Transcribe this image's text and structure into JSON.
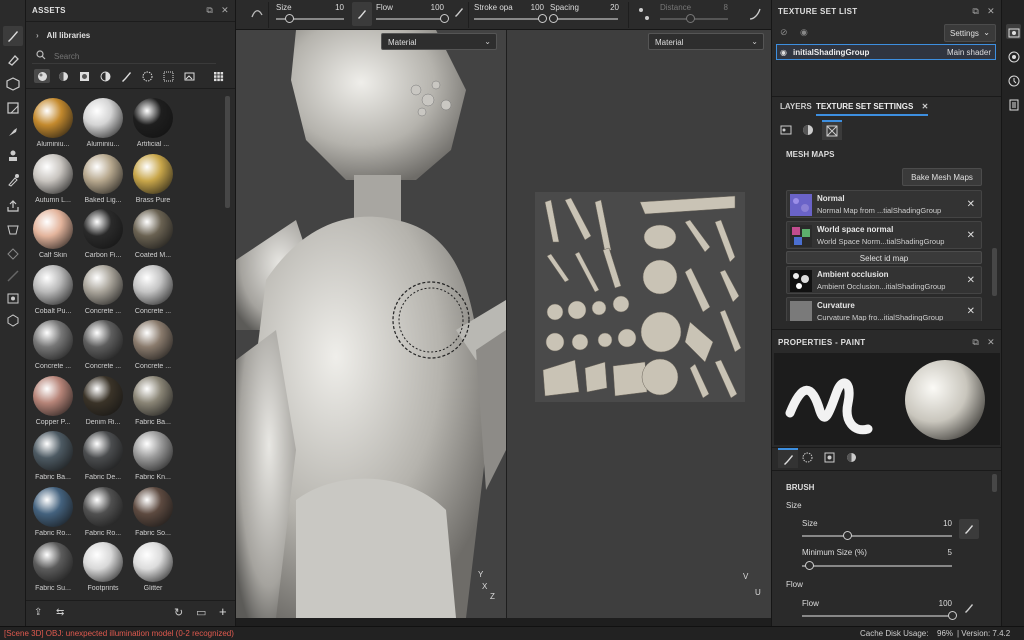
{
  "assets": {
    "title": "ASSETS",
    "all_libraries": "All libraries",
    "search_placeholder": "Search",
    "materials": [
      {
        "label": "Aluminiu...",
        "color": "#c48a2e"
      },
      {
        "label": "Aluminiu...",
        "color": "#d4d4d4"
      },
      {
        "label": "Artificial ...",
        "color": "#1e1e1e"
      },
      {
        "label": "Autumn L...",
        "color": "#c9c5c0"
      },
      {
        "label": "Baked Lig...",
        "color": "#b7a88e"
      },
      {
        "label": "Brass Pure",
        "color": "#c8a64a"
      },
      {
        "label": "Calf Skin",
        "color": "#e3b49c"
      },
      {
        "label": "Carbon Fi...",
        "color": "#2a2a2a"
      },
      {
        "label": "Coated M...",
        "color": "#6a6252"
      },
      {
        "label": "Cobalt Pu...",
        "color": "#b9b9b9"
      },
      {
        "label": "Concrete ...",
        "color": "#a9a49a"
      },
      {
        "label": "Concrete ...",
        "color": "#c4c4c4"
      },
      {
        "label": "Concrete ...",
        "color": "#777777"
      },
      {
        "label": "Concrete ...",
        "color": "#5e5e5e"
      },
      {
        "label": "Concrete ...",
        "color": "#8a7b6d"
      },
      {
        "label": "Copper P...",
        "color": "#b68478"
      },
      {
        "label": "Denim Ri...",
        "color": "#3a3328"
      },
      {
        "label": "Fabric Ba...",
        "color": "#8a8576"
      },
      {
        "label": "Fabric Ba...",
        "color": "#4d5a63"
      },
      {
        "label": "Fabric De...",
        "color": "#4b4d4f"
      },
      {
        "label": "Fabric Kn...",
        "color": "#9a9a9a"
      },
      {
        "label": "Fabric Ro...",
        "color": "#44627e"
      },
      {
        "label": "Fabric Ro...",
        "color": "#505050"
      },
      {
        "label": "Fabric So...",
        "color": "#5d4a40"
      },
      {
        "label": "Fabric Su...",
        "color": "#5c5c5c"
      },
      {
        "label": "Footprints",
        "color": "#d8d8d8"
      },
      {
        "label": "Glitter",
        "color": "#dcdcdc"
      }
    ]
  },
  "toolbar": {
    "size_label": "Size",
    "size_value": "10",
    "size_fraction": 0.2,
    "flow_label": "Flow",
    "flow_value": "100",
    "flow_fraction": 1.0,
    "stroke_label": "Stroke opa",
    "stroke_value": "100",
    "stroke_fraction": 1.0,
    "spacing_label": "Spacing",
    "spacing_value": "20",
    "spacing_fraction": 0.05,
    "distance_label": "Distance",
    "distance_value": "8",
    "distance_fraction": 0.45
  },
  "viewport": {
    "left_dropdown": "Material",
    "right_dropdown": "Material",
    "axis_y": "Y",
    "axis_x": "X",
    "axis_z": "Z",
    "axis2_v": "V",
    "axis2_u": "U"
  },
  "texture_set_list": {
    "title": "TEXTURE SET LIST",
    "settings_button": "Settings",
    "set_name": "initialShadingGroup",
    "shader": "Main shader"
  },
  "tabs": {
    "layers": "LAYERS",
    "texture_set_settings": "TEXTURE SET SETTINGS"
  },
  "mesh_maps": {
    "title": "MESH MAPS",
    "bake_button": "Bake Mesh Maps",
    "select_id_map": "Select id map",
    "items": [
      {
        "title": "Normal",
        "sub": "Normal Map from ...tialShadingGroup"
      },
      {
        "title": "World space normal",
        "sub": "World Space Norm...tialShadingGroup"
      },
      {
        "title": "Ambient occlusion",
        "sub": "Ambient Occlusion...itialShadingGroup"
      },
      {
        "title": "Curvature",
        "sub": "Curvature Map fro...itialShadingGroup"
      }
    ]
  },
  "properties": {
    "title": "PROPERTIES - PAINT",
    "brush_section": "BRUSH",
    "size_group": "Size",
    "size_label": "Size",
    "size_value": "10",
    "size_fraction": 0.3,
    "min_size_label": "Minimum Size (%)",
    "min_size_value": "5",
    "min_size_fraction": 0.05,
    "flow_group": "Flow",
    "flow_label": "Flow",
    "flow_value": "100",
    "flow_fraction": 1.0
  },
  "status": {
    "error": "[Scene 3D] OBJ: unexpected illumination model (0-2 recognized)",
    "cache": "Cache Disk Usage:",
    "cache_value": "96%",
    "version": "| Version: 7.4.2",
    "error_color": "#e05a4f"
  }
}
